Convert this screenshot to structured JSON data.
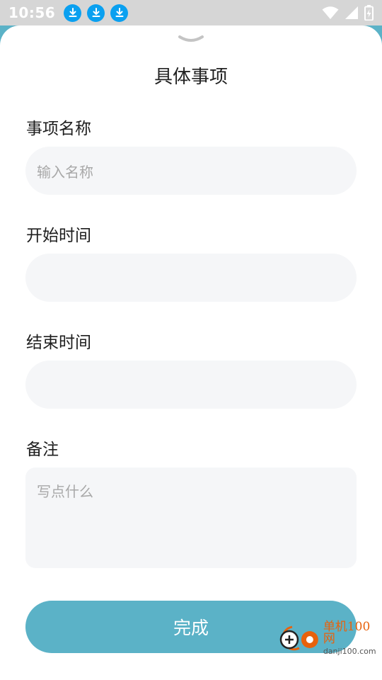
{
  "status_bar": {
    "time": "10:56",
    "download_icon_count": 3
  },
  "sheet": {
    "title": "具体事项",
    "fields": [
      {
        "label": "事项名称",
        "placeholder": "输入名称",
        "value": ""
      },
      {
        "label": "开始时间",
        "placeholder": "",
        "value": ""
      },
      {
        "label": "结束时间",
        "placeholder": "",
        "value": ""
      }
    ],
    "notes": {
      "label": "备注",
      "placeholder": "写点什么"
    },
    "done_label": "完成"
  },
  "watermark": {
    "brand_cn": "单机100网",
    "brand_url": "danji100.com"
  },
  "colors": {
    "accent": "#5bb2c7",
    "field_bg": "#f5f6f8",
    "status_bar": "#d6d6d6",
    "download_badge": "#0aa0f0"
  }
}
